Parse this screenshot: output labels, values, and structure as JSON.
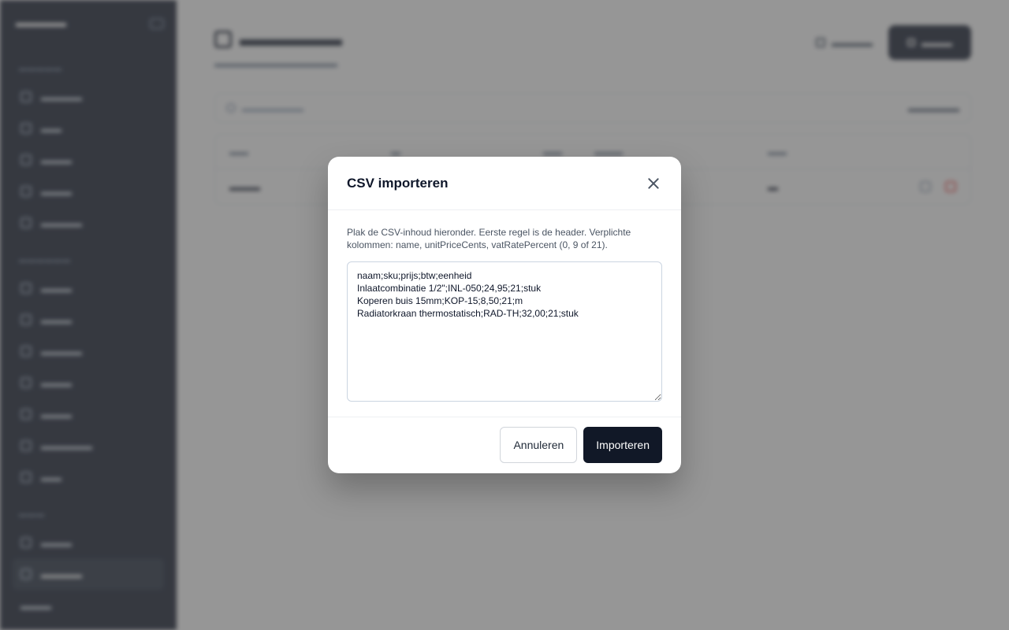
{
  "modal": {
    "title": "CSV importeren",
    "description": "Plak de CSV-inhoud hieronder. Eerste regel is de header. Verplichte kolommen: name, unitPriceCents, vatRatePercent (0, 9 of 21).",
    "csv_value": "naam;sku;prijs;btw;eenheid\nInlaatcombinatie 1/2\";INL-050;24,95;21;stuk\nKoperen buis 15mm;KOP-15;8,50;21;m\nRadiatorkraan thermostatisch;RAD-TH;32,00;21;stuk",
    "cancel_label": "Annuleren",
    "import_label": "Importeren"
  }
}
